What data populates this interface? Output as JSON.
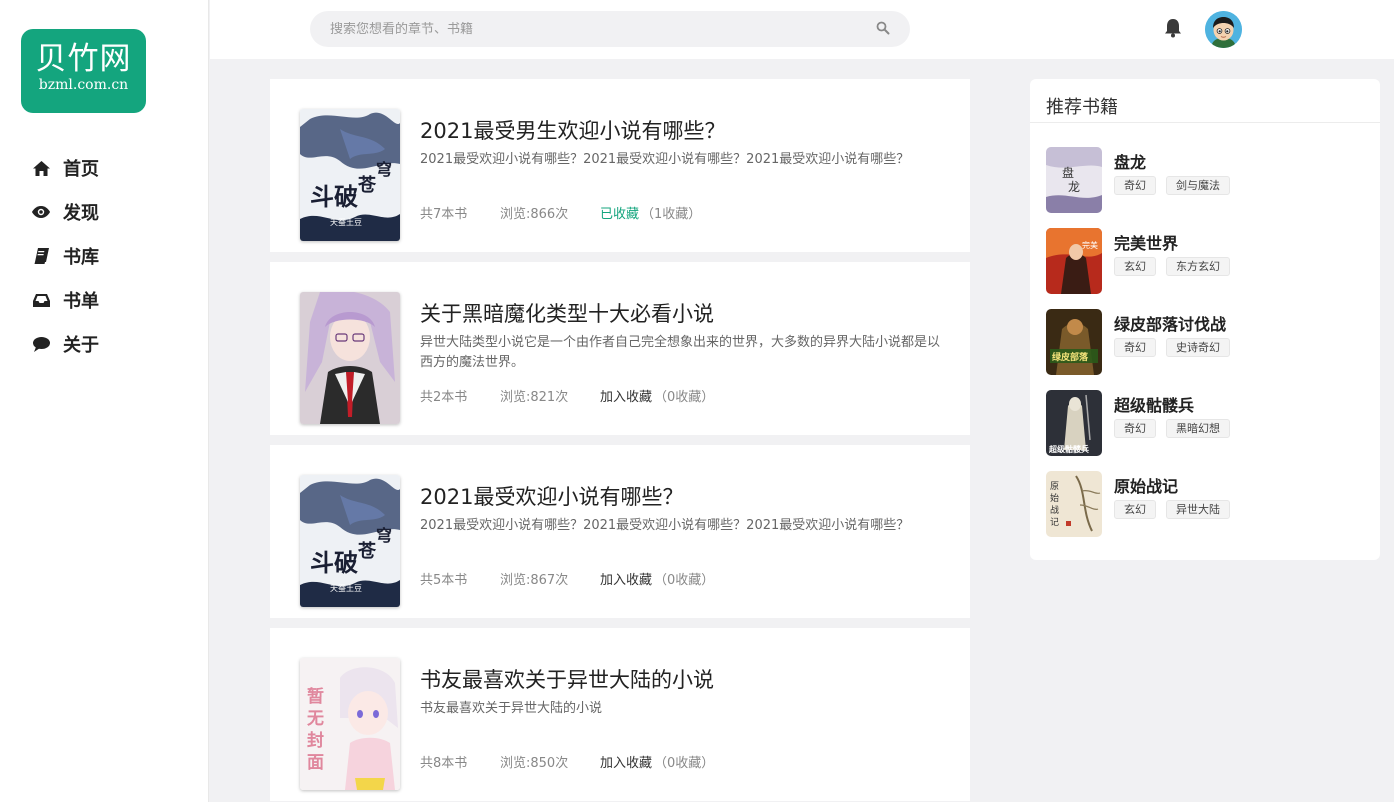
{
  "logo": {
    "main": "贝竹网",
    "sub": "bzml.com.cn"
  },
  "nav": [
    {
      "label": "首页",
      "icon": "home-icon"
    },
    {
      "label": "发现",
      "icon": "eye-icon"
    },
    {
      "label": "书库",
      "icon": "book-icon"
    },
    {
      "label": "书单",
      "icon": "inbox-icon"
    },
    {
      "label": "关于",
      "icon": "comment-icon"
    }
  ],
  "search": {
    "placeholder": "搜索您想看的章节、书籍",
    "value": ""
  },
  "booklists": [
    {
      "title": "2021最受男生欢迎小说有哪些？",
      "desc": "2021最受欢迎小说有哪些？2021最受欢迎小说有哪些？2021最受欢迎小说有哪些？",
      "count": "共7本书",
      "views": "浏览:866次",
      "fav_label": "已收藏",
      "fav_count": "（1收藏）",
      "favorited": true,
      "cover_text": "斗破苍穹",
      "cover_author": "天蚕土豆"
    },
    {
      "title": "关于黑暗魔化类型十大必看小说",
      "desc": "异世大陆类型小说它是一个由作者自己完全想象出来的世界，大多数的异界大陆小说都是以西方的魔法世界。",
      "count": "共2本书",
      "views": "浏览:821次",
      "fav_label": "加入收藏",
      "fav_count": "（0收藏）",
      "favorited": false
    },
    {
      "title": "2021最受欢迎小说有哪些？",
      "desc": "2021最受欢迎小说有哪些？2021最受欢迎小说有哪些？2021最受欢迎小说有哪些？",
      "count": "共5本书",
      "views": "浏览:867次",
      "fav_label": "加入收藏",
      "fav_count": "（0收藏）",
      "favorited": false,
      "cover_text": "斗破苍穹",
      "cover_author": "天蚕土豆"
    },
    {
      "title": "书友最喜欢关于异世大陆的小说",
      "desc": "书友最喜欢关于异世大陆的小说",
      "count": "共8本书",
      "views": "浏览:850次",
      "fav_label": "加入收藏",
      "fav_count": "（0收藏）",
      "favorited": false,
      "cover_text": "暂无封面"
    }
  ],
  "recommend": {
    "title": "推荐书籍",
    "books": [
      {
        "name": "盘龙",
        "tags": [
          "奇幻",
          "剑与魔法"
        ],
        "cover_text": "盘龙"
      },
      {
        "name": "完美世界",
        "tags": [
          "玄幻",
          "东方玄幻"
        ],
        "cover_text": "完美世界"
      },
      {
        "name": "绿皮部落讨伐战",
        "tags": [
          "奇幻",
          "史诗奇幻"
        ],
        "cover_text": "绿皮部落讨伐战"
      },
      {
        "name": "超级骷髅兵",
        "tags": [
          "奇幻",
          "黑暗幻想"
        ],
        "cover_text": "超级骷髅兵"
      },
      {
        "name": "原始战记",
        "tags": [
          "玄幻",
          "异世大陆"
        ],
        "cover_text": "原始战记"
      }
    ]
  },
  "colors": {
    "brand": "#14a57e",
    "favorited": "#14a57e"
  }
}
